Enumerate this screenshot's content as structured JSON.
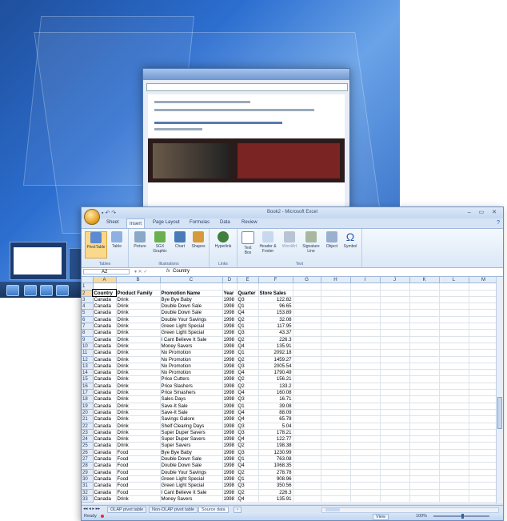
{
  "window": {
    "title": "Book2 - Microsoft Excel"
  },
  "qat": {
    "icons": [
      "save-icon",
      "undo-icon",
      "redo-icon"
    ]
  },
  "window_controls": {
    "text": "– ▭ ✕"
  },
  "tabs": [
    "Sheet",
    "Insert",
    "Page Layout",
    "Formulas",
    "Data",
    "Review"
  ],
  "active_tab": "Insert",
  "ribbon": {
    "groups": [
      {
        "label": "Tables",
        "buttons": [
          "PivotTable",
          "Table"
        ]
      },
      {
        "label": "Illustrations",
        "buttons": [
          "Picture",
          "SGX Graphic",
          "Chart",
          "Shapes"
        ]
      },
      {
        "label": "Links",
        "buttons": [
          "Hyperlink"
        ]
      },
      {
        "label": "Text",
        "buttons": [
          "Text Box",
          "Header & Footer",
          "WordArt",
          "Signature Line",
          "Object",
          "Symbol"
        ]
      }
    ]
  },
  "formula_bar": {
    "name_box": "A2",
    "fx": "fx",
    "value": "Country"
  },
  "columns": [
    "A",
    "B",
    "C",
    "D",
    "E",
    "F",
    "G",
    "H",
    "I",
    "J",
    "K",
    "L",
    "M"
  ],
  "rows": [
    {
      "n": "1",
      "cells": [
        "",
        "",
        "",
        "",
        "",
        ""
      ]
    },
    {
      "n": "2",
      "cells": [
        "Country",
        "Product Family",
        "Promotion Name",
        "Year",
        "Quarter",
        "Store Sales"
      ]
    },
    {
      "n": "3",
      "cells": [
        "Canada",
        "Drink",
        "Bye Bye Baby",
        "1998",
        "Q3",
        "122.82"
      ]
    },
    {
      "n": "4",
      "cells": [
        "Canada",
        "Drink",
        "Double Down Sale",
        "1998",
        "Q1",
        "96.65"
      ]
    },
    {
      "n": "5",
      "cells": [
        "Canada",
        "Drink",
        "Double Down Sale",
        "1998",
        "Q4",
        "153.89"
      ]
    },
    {
      "n": "6",
      "cells": [
        "Canada",
        "Drink",
        "Double Your Savings",
        "1998",
        "Q2",
        "32.08"
      ]
    },
    {
      "n": "7",
      "cells": [
        "Canada",
        "Drink",
        "Green Light Special",
        "1998",
        "Q1",
        "117.95"
      ]
    },
    {
      "n": "8",
      "cells": [
        "Canada",
        "Drink",
        "Green Light Special",
        "1998",
        "Q3",
        "43.37"
      ]
    },
    {
      "n": "9",
      "cells": [
        "Canada",
        "Drink",
        "I Cant Believe It Sale",
        "1998",
        "Q2",
        "226.3"
      ]
    },
    {
      "n": "10",
      "cells": [
        "Canada",
        "Drink",
        "Money Savers",
        "1998",
        "Q4",
        "135.91"
      ]
    },
    {
      "n": "11",
      "cells": [
        "Canada",
        "Drink",
        "No Promotion",
        "1998",
        "Q1",
        "2092.18"
      ]
    },
    {
      "n": "12",
      "cells": [
        "Canada",
        "Drink",
        "No Promotion",
        "1998",
        "Q2",
        "1459.27"
      ]
    },
    {
      "n": "13",
      "cells": [
        "Canada",
        "Drink",
        "No Promotion",
        "1998",
        "Q3",
        "2005.54"
      ]
    },
    {
      "n": "14",
      "cells": [
        "Canada",
        "Drink",
        "No Promotion",
        "1998",
        "Q4",
        "1790.49"
      ]
    },
    {
      "n": "15",
      "cells": [
        "Canada",
        "Drink",
        "Price Cutters",
        "1998",
        "Q2",
        "156.21"
      ]
    },
    {
      "n": "16",
      "cells": [
        "Canada",
        "Drink",
        "Price Slashers",
        "1998",
        "Q2",
        "133.2"
      ]
    },
    {
      "n": "17",
      "cells": [
        "Canada",
        "Drink",
        "Price Smashers",
        "1998",
        "Q4",
        "160.08"
      ]
    },
    {
      "n": "18",
      "cells": [
        "Canada",
        "Drink",
        "Sales Days",
        "1998",
        "Q3",
        "16.71"
      ]
    },
    {
      "n": "19",
      "cells": [
        "Canada",
        "Drink",
        "Save-It Sale",
        "1998",
        "Q1",
        "39.08"
      ]
    },
    {
      "n": "20",
      "cells": [
        "Canada",
        "Drink",
        "Save-It Sale",
        "1998",
        "Q4",
        "88.09"
      ]
    },
    {
      "n": "21",
      "cells": [
        "Canada",
        "Drink",
        "Savings Galore",
        "1998",
        "Q4",
        "65.78"
      ]
    },
    {
      "n": "22",
      "cells": [
        "Canada",
        "Drink",
        "Shelf Clearing Days",
        "1998",
        "Q3",
        "5.04"
      ]
    },
    {
      "n": "23",
      "cells": [
        "Canada",
        "Drink",
        "Super Duper Savers",
        "1998",
        "Q3",
        "178.21"
      ]
    },
    {
      "n": "24",
      "cells": [
        "Canada",
        "Drink",
        "Super Duper Savers",
        "1998",
        "Q4",
        "122.77"
      ]
    },
    {
      "n": "25",
      "cells": [
        "Canada",
        "Drink",
        "Super Savers",
        "1998",
        "Q2",
        "198.38"
      ]
    },
    {
      "n": "26",
      "cells": [
        "Canada",
        "Food",
        "Bye Bye Baby",
        "1998",
        "Q3",
        "1230.99"
      ]
    },
    {
      "n": "27",
      "cells": [
        "Canada",
        "Food",
        "Double Down Sale",
        "1998",
        "Q1",
        "763.08"
      ]
    },
    {
      "n": "28",
      "cells": [
        "Canada",
        "Food",
        "Double Down Sale",
        "1998",
        "Q4",
        "1068.35"
      ]
    },
    {
      "n": "29",
      "cells": [
        "Canada",
        "Food",
        "Double Your Savings",
        "1998",
        "Q2",
        "278.78"
      ]
    },
    {
      "n": "30",
      "cells": [
        "Canada",
        "Food",
        "Green Light Special",
        "1998",
        "Q1",
        "908.96"
      ]
    },
    {
      "n": "31",
      "cells": [
        "Canada",
        "Food",
        "Green Light Special",
        "1998",
        "Q3",
        "350.56"
      ]
    },
    {
      "n": "32",
      "cells": [
        "Canada",
        "Food",
        "I Cant Believe It Sale",
        "1998",
        "Q2",
        "226.3"
      ]
    },
    {
      "n": "33",
      "cells": [
        "Canada",
        "Drink",
        "Money Savers",
        "1998",
        "Q4",
        "135.91"
      ]
    }
  ],
  "sheet_tabs": [
    "OLAP pivot table",
    "Non-OLAP pivot table",
    "Source data"
  ],
  "active_sheet": "Source data",
  "status": {
    "ready": "Ready",
    "view": "View",
    "zoom": "100%"
  }
}
